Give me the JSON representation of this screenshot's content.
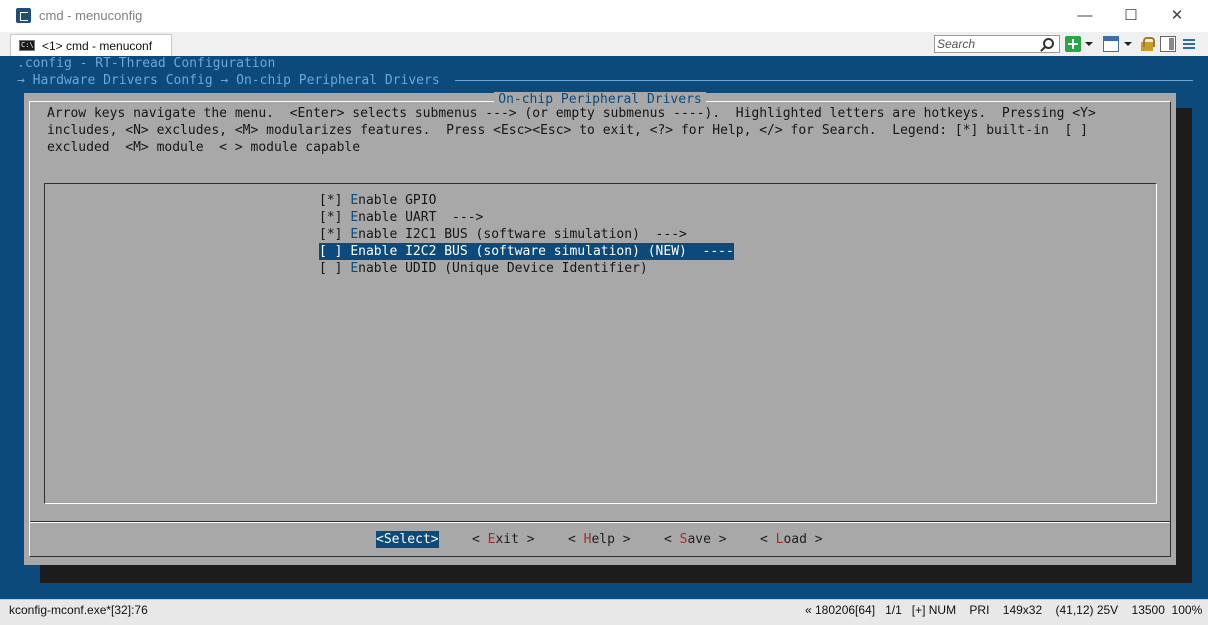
{
  "window": {
    "title": "cmd - menuconfig",
    "minimize": "—",
    "maximize": "☐",
    "close": "✕"
  },
  "tab": {
    "icon_glyph": "C:\\",
    "label": "<1> cmd - menuconf"
  },
  "toolbar": {
    "search_placeholder": "Search"
  },
  "terminal": {
    "config_line": ".config - RT-Thread Configuration",
    "breadcrumb": "→ Hardware Drivers Config → On-chip Peripheral Drivers"
  },
  "dialog": {
    "title": "On-chip Peripheral Drivers",
    "help_lines": [
      "Arrow keys navigate the menu.  <Enter> selects submenus ---> (or empty submenus ----).  Highlighted letters are hotkeys.  Pressing <Y>",
      "includes, <N> excludes, <M> modularizes features.  Press <Esc><Esc> to exit, <?> for Help, </> for Search.  Legend: [*] built-in  [ ]",
      "excluded  <M> module  < > module capable"
    ],
    "items": [
      {
        "prefix": "[*] ",
        "hotkey": "E",
        "rest": "nable GPIO"
      },
      {
        "prefix": "[*] ",
        "hotkey": "E",
        "rest": "nable UART  --->"
      },
      {
        "prefix": "[*] ",
        "hotkey": "E",
        "rest": "nable I2C1 BUS (software simulation)  --->"
      },
      {
        "prefix": "[ ] ",
        "hotkey": "E",
        "rest": "nable I2C2 BUS (software simulation) (NEW)  ----"
      },
      {
        "prefix": "[ ] ",
        "hotkey": "E",
        "rest": "nable UDID (Unique Device Identifier)"
      }
    ],
    "selected_index": 3,
    "buttons": {
      "select": "<Select>",
      "exit": {
        "pre": "< ",
        "hotkey": "E",
        "rest": "xit >"
      },
      "help": {
        "pre": "< ",
        "hotkey": "H",
        "rest": "elp >"
      },
      "save": {
        "pre": "< ",
        "hotkey": "S",
        "rest": "ave >"
      },
      "load": {
        "pre": "< ",
        "hotkey": "L",
        "rest": "oad >"
      }
    }
  },
  "statusbar": {
    "process": "kconfig-mconf.exe*[32]:76",
    "info": "« 180206[64]   1/1   [+] NUM    PRI    149x32    (41,12) 25V    13500  100%"
  },
  "colors": {
    "terminal_bg": "#0c4a7c",
    "dialog_bg": "#a8a8a8",
    "hotkey": "#0c4a7c",
    "button_hotkey": "#a03030"
  }
}
